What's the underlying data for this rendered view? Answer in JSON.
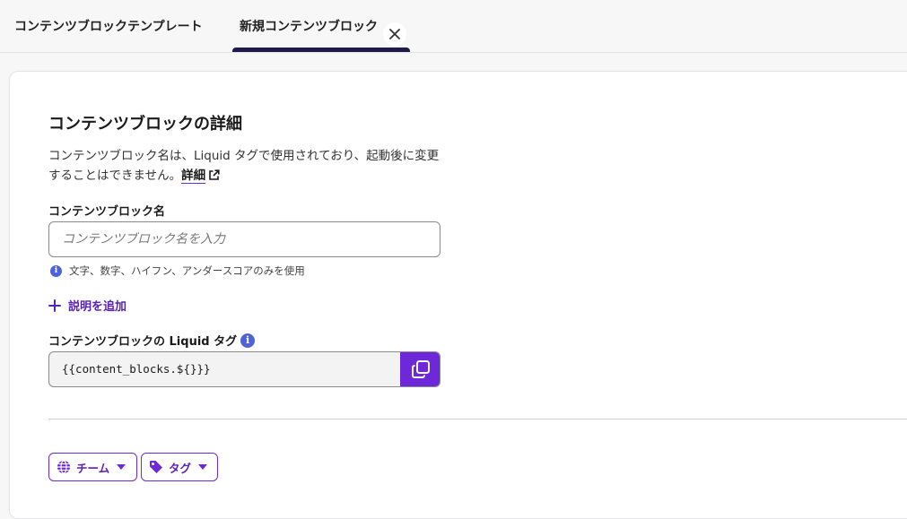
{
  "tabs": [
    {
      "label": "コンテンツブロックテンプレート"
    },
    {
      "label": "新規コンテンツブロック"
    }
  ],
  "details": {
    "title": "コンテンツブロックの詳細",
    "description": "コンテンツブロック名は、Liquid タグで使用されており、起動後に変更することはできません。",
    "learn_more": "詳細"
  },
  "name_field": {
    "label": "コンテンツブロック名",
    "placeholder": "コンテンツブロック名を入力",
    "value": "",
    "hint": "文字、数字、ハイフン、アンダースコアのみを使用"
  },
  "add_description": "説明を追加",
  "liquid": {
    "label": "コンテンツブロックの Liquid タグ",
    "value": "{{content_blocks.${}}}"
  },
  "filters": {
    "team": "チーム",
    "tag": "タグ"
  },
  "colors": {
    "accent": "#6d28d9",
    "tab_indicator": "#1e1b4b",
    "info": "#4f63d8"
  }
}
